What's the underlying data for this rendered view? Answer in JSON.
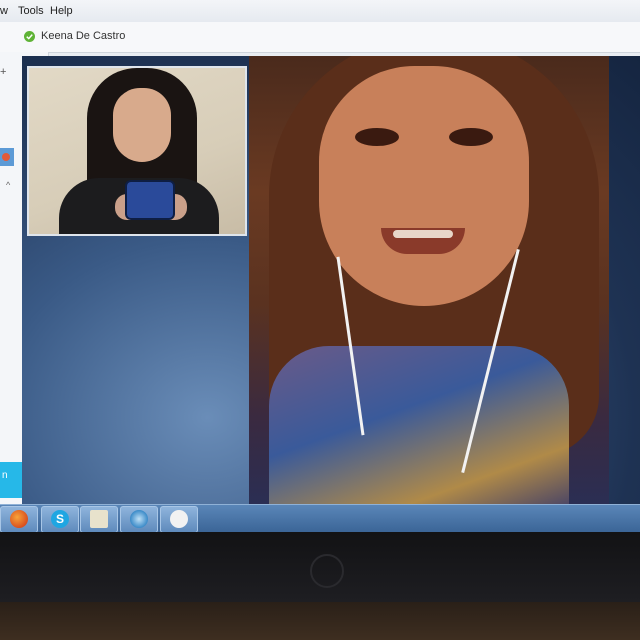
{
  "menubar": {
    "items": [
      "w",
      "Tools",
      "Help"
    ]
  },
  "conversation": {
    "contact_name": "Keena De Castro",
    "status_icon": "online-status-icon"
  },
  "sidebar": {
    "add_symbol": "+",
    "caret_symbol": "^",
    "notification": {
      "text": "n",
      "close_symbol": "×"
    }
  },
  "taskbar": {
    "items": [
      {
        "name": "firefox",
        "glyph": ""
      },
      {
        "name": "skype",
        "glyph": "S"
      },
      {
        "name": "file-manager",
        "glyph": ""
      },
      {
        "name": "media",
        "glyph": ""
      },
      {
        "name": "app",
        "glyph": ""
      }
    ]
  },
  "colors": {
    "skype_blue": "#26b8e8",
    "call_background": "#1e3253",
    "taskbar": "#3a6496",
    "online_green": "#5fb336"
  }
}
